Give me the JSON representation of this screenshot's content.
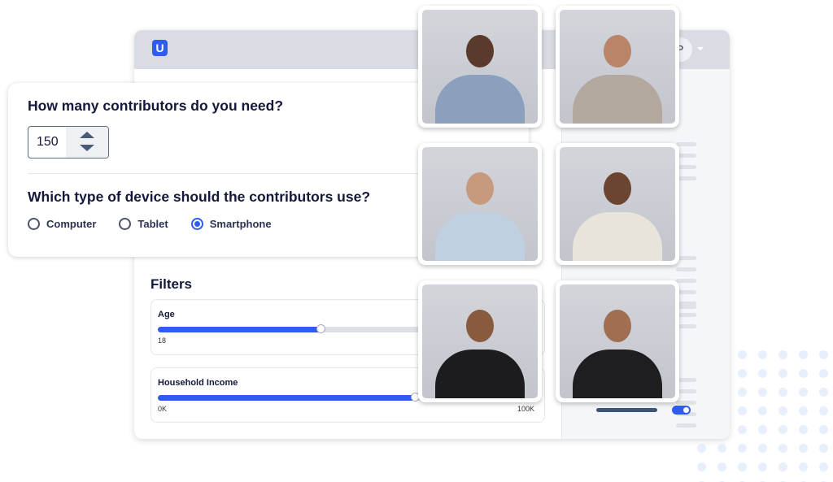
{
  "app": {
    "logo": "U",
    "avatar_initial": "P"
  },
  "contributors": {
    "question": "How many contributors do you need?",
    "value": "150"
  },
  "device": {
    "question": "Which type of device should the contributors use?",
    "options": [
      {
        "label": "Computer",
        "selected": false
      },
      {
        "label": "Tablet",
        "selected": false
      },
      {
        "label": "Smartphone",
        "selected": true
      }
    ]
  },
  "filters": {
    "title": "Filters",
    "age": {
      "label": "Age",
      "min_label": "18",
      "fill_fraction": 0.43
    },
    "income": {
      "label": "Household Income",
      "min_label": "0K",
      "max_label": "100K",
      "fill_fraction": 0.68
    }
  },
  "toggle": {
    "on": true
  },
  "colors": {
    "accent": "#2f5bf0",
    "text": "#14183a",
    "header": "#d9dce2"
  },
  "photos": [
    {
      "shirt": "#8aa0bd",
      "skin": "#5a3a2a"
    },
    {
      "shirt": "#b3a89e",
      "skin": "#b98468"
    },
    {
      "shirt": "#bfd0e0",
      "skin": "#c79a7d"
    },
    {
      "shirt": "#e8e4dc",
      "skin": "#6b4530"
    },
    {
      "shirt": "#1c1c1e",
      "skin": "#8a5a3e"
    },
    {
      "shirt": "#1e1e20",
      "skin": "#a06f52"
    }
  ]
}
